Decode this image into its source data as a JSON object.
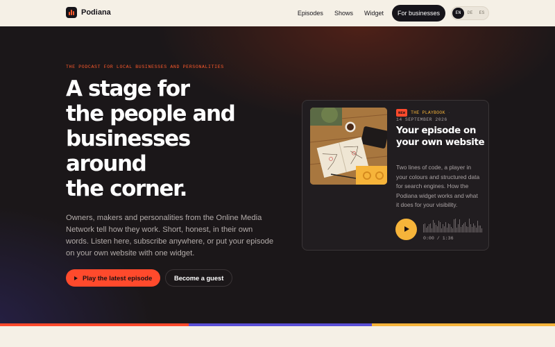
{
  "brand": {
    "name": "Podiana"
  },
  "nav": {
    "links": [
      "Episodes",
      "Shows",
      "Widget"
    ],
    "cta": "For businesses",
    "languages": [
      "EN",
      "DE",
      "ES"
    ],
    "active_language": "EN"
  },
  "hero": {
    "kicker": "THE PODCAST FOR LOCAL BUSINESSES AND PERSONALITIES",
    "headline_lines": [
      "A stage for",
      "the people and",
      "businesses",
      "around",
      "the corner."
    ],
    "lead": "Owners, makers and personalities from the Online Media Network tell how they work. Short, honest, in their own words. Listen here, subscribe anywhere, or put your episode on your own website with one widget.",
    "primary_button": "Play the latest episode",
    "secondary_button": "Become a guest"
  },
  "episode_card": {
    "badge": "NEW",
    "show": "THE PLAYBOOK",
    "separator": "·",
    "date": "14 SEPTEMBER 2026",
    "title": "Your episode on your own website",
    "description": "Two lines of code, a player in your colours and structured data for search engines. How the Podiana widget works and what it does for your visibility.",
    "player": {
      "elapsed": "0:00",
      "divider": "/",
      "duration": "1:36",
      "progress": 0
    }
  },
  "colors": {
    "accent_orange": "#ff4a2c",
    "accent_amber": "#f6b43a",
    "accent_violet": "#5a4fd6",
    "hero_bg": "#1b1719",
    "cream": "#f5f0e6"
  },
  "icons": {
    "logo": "bar-chart-icon",
    "play_button": "play-icon",
    "player": "play-icon"
  }
}
